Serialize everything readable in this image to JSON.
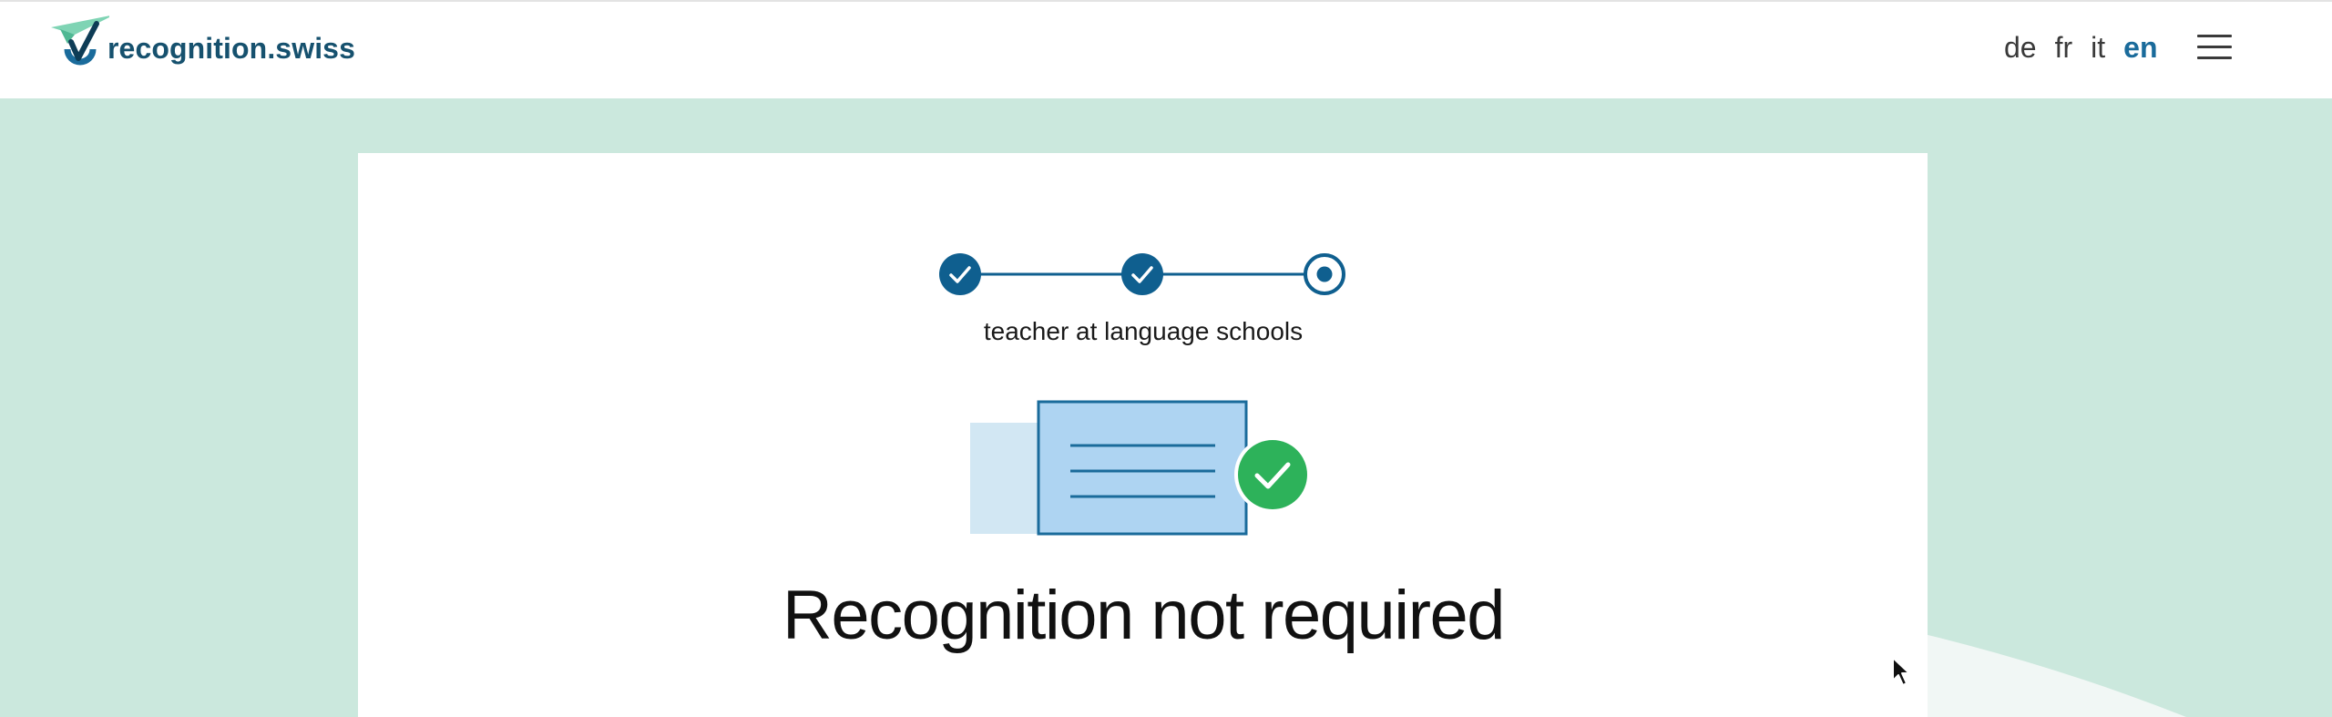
{
  "header": {
    "logo_text": "recognition.swiss",
    "languages": [
      {
        "code": "de",
        "label": "de",
        "active": false
      },
      {
        "code": "fr",
        "label": "fr",
        "active": false
      },
      {
        "code": "it",
        "label": "it",
        "active": false
      },
      {
        "code": "en",
        "label": "en",
        "active": true
      }
    ],
    "menu_icon": "hamburger-menu-icon"
  },
  "stepper": {
    "steps": [
      {
        "status": "completed",
        "icon": "check-icon"
      },
      {
        "status": "completed",
        "icon": "check-icon"
      },
      {
        "status": "current",
        "icon": "dot-icon"
      }
    ],
    "label": "teacher at language schools"
  },
  "result": {
    "illustration_icon": "document-approved-icon",
    "headline": "Recognition not required"
  },
  "colors": {
    "brand_dark": "#16516e",
    "brand_blue": "#1a6b9b",
    "step_blue": "#0f5f8f",
    "background_mint": "#cbe8dd",
    "success_green": "#2db25a",
    "doc_light_blue": "#aed4f2",
    "doc_pale_blue": "#d2e7f3"
  }
}
